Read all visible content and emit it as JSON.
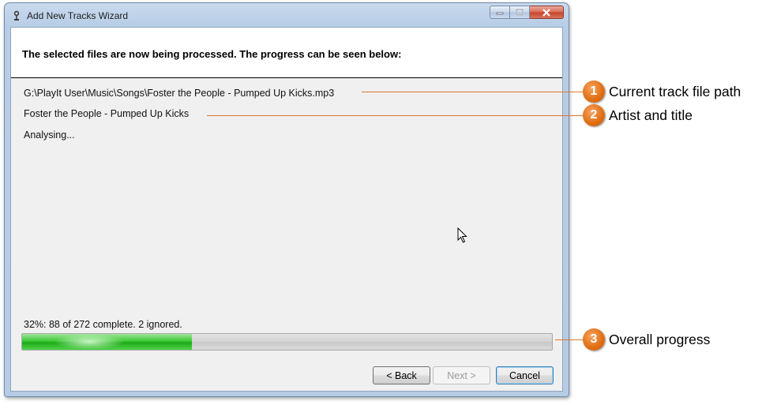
{
  "window": {
    "title": "Add New Tracks Wizard",
    "header": "The selected files are now being processed. The progress can be seen below:"
  },
  "track": {
    "file_path": "G:\\PlayIt User\\Music\\Songs\\Foster the People - Pumped Up Kicks.mp3",
    "artist_title": "Foster the People - Pumped Up Kicks",
    "status": "Analysing..."
  },
  "progress": {
    "text": "32%: 88 of 272 complete. 2 ignored.",
    "fraction": 0.32
  },
  "buttons": {
    "back": "< Back",
    "next": "Next >",
    "cancel": "Cancel"
  },
  "callouts": [
    {
      "number": "1",
      "label": "Current track file path"
    },
    {
      "number": "2",
      "label": "Artist and title"
    },
    {
      "number": "3",
      "label": "Overall progress"
    }
  ],
  "colors": {
    "callout_accent": "#e06d12",
    "progress_green": "#2fbf28"
  },
  "icons": [
    "app-icon",
    "minimize-icon",
    "maximize-icon",
    "close-icon",
    "mouse-cursor-icon"
  ]
}
